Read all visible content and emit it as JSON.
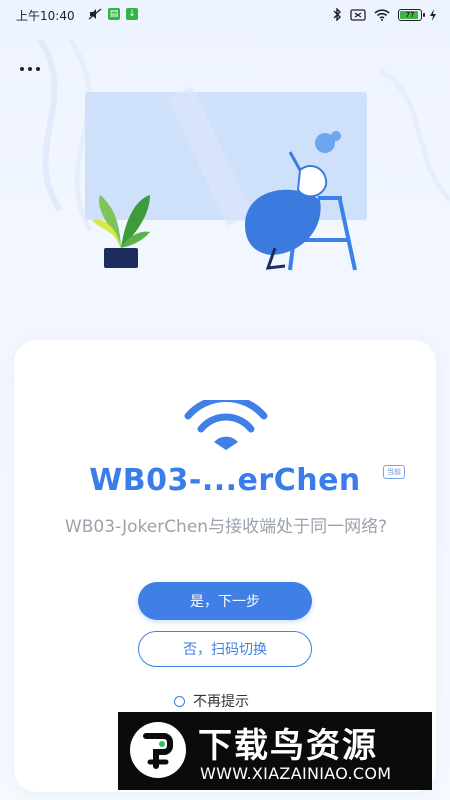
{
  "status_bar": {
    "time": "上午10:40",
    "battery_level": "77"
  },
  "dialog": {
    "device_name": "WB03-...erChen",
    "current_tag": "当前",
    "question": "WB03-JokerChen与接收端处于同一网络?",
    "confirm_label": "是，下一步",
    "switch_label": "否，扫码切换",
    "no_remind_label": "不再提示"
  },
  "watermark": {
    "brand": "下载鸟资源",
    "url": "WWW.XIAZAINIAO.COM"
  },
  "colors": {
    "accent": "#3f7fe6",
    "question_text": "#9aa3ad",
    "background": "#eef4ff"
  },
  "icons": [
    "more-dots-icon",
    "wifi-icon",
    "bluetooth-icon",
    "battery-icon",
    "radio-icon"
  ]
}
